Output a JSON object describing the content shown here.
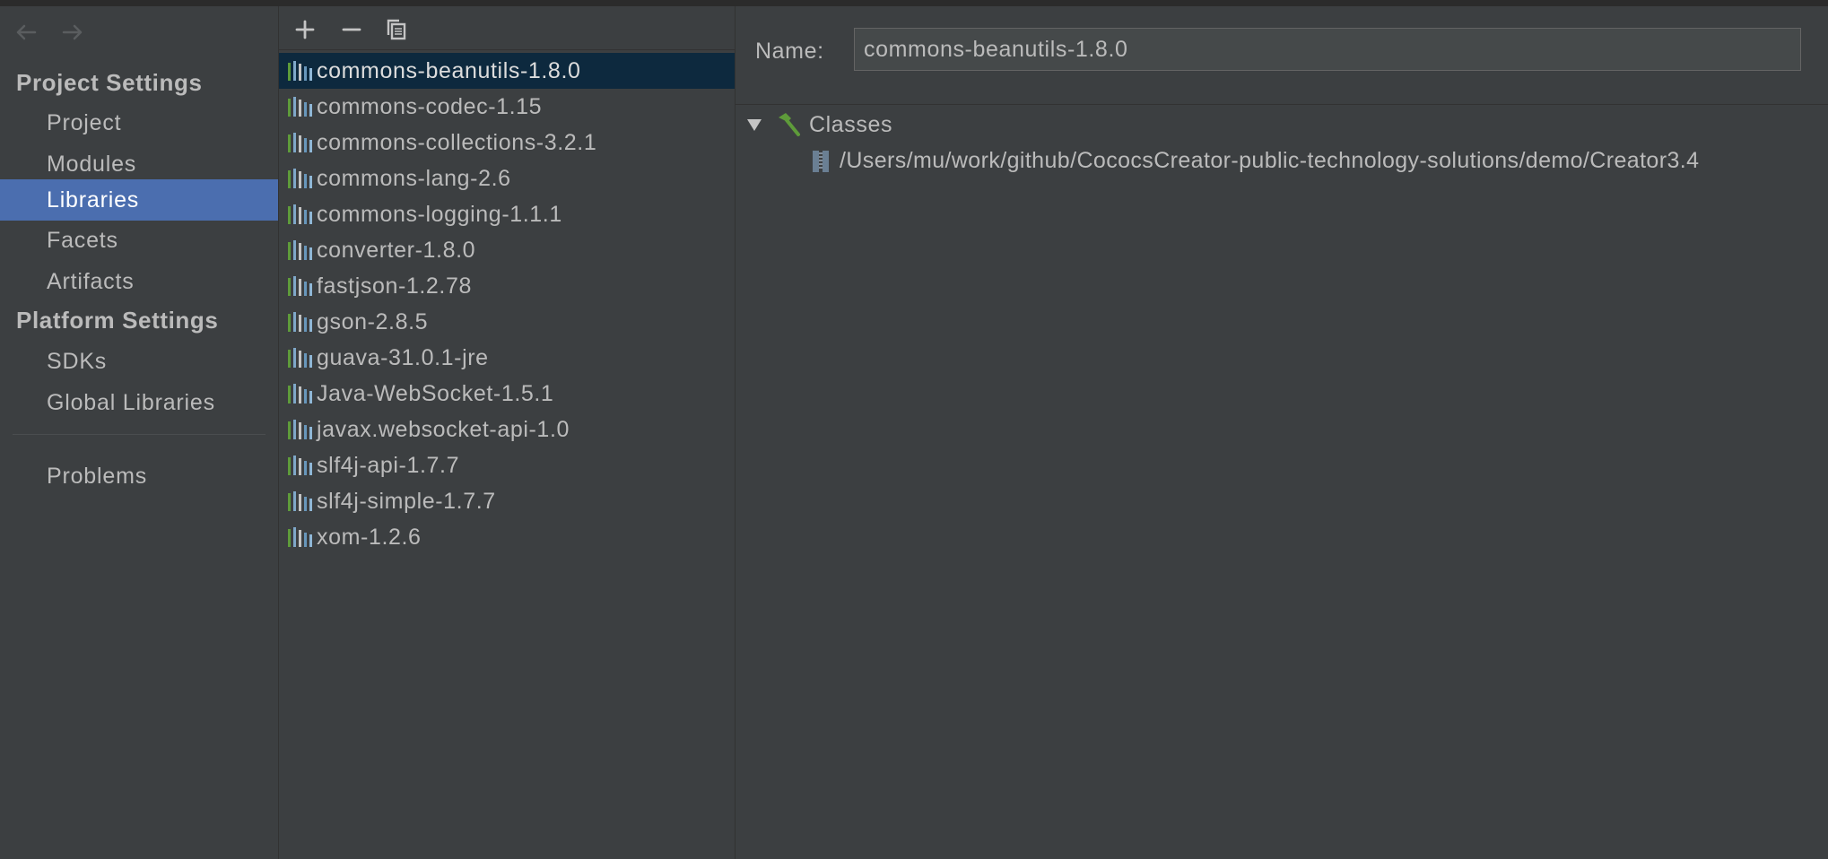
{
  "sidebar": {
    "project_settings_title": "Project Settings",
    "project_items": [
      {
        "label": "Project",
        "selected": false
      },
      {
        "label": "Modules",
        "selected": false
      },
      {
        "label": "Libraries",
        "selected": true
      },
      {
        "label": "Facets",
        "selected": false
      },
      {
        "label": "Artifacts",
        "selected": false
      }
    ],
    "platform_settings_title": "Platform Settings",
    "platform_items": [
      {
        "label": "SDKs"
      },
      {
        "label": "Global Libraries"
      }
    ],
    "problems_label": "Problems"
  },
  "toolbar": {
    "add_icon": "plus-icon",
    "remove_icon": "minus-icon",
    "copy_icon": "copy-icon"
  },
  "libraries": [
    "commons-beanutils-1.8.0",
    "commons-codec-1.15",
    "commons-collections-3.2.1",
    "commons-lang-2.6",
    "commons-logging-1.1.1",
    "converter-1.8.0",
    "fastjson-1.2.78",
    "gson-2.8.5",
    "guava-31.0.1-jre",
    "Java-WebSocket-1.5.1",
    "javax.websocket-api-1.0",
    "slf4j-api-1.7.7",
    "slf4j-simple-1.7.7",
    "xom-1.2.6"
  ],
  "selected_library_index": 0,
  "detail": {
    "name_label": "Name:",
    "name_value": "commons-beanutils-1.8.0",
    "classes_label": "Classes",
    "class_path": "/Users/mu/work/github/CococsCreator-public-technology-solutions/demo/Creator3.4"
  },
  "colors": {
    "background": "#3c3f41",
    "sidebar_selected": "#4b6eaf",
    "list_selected": "#0d293e",
    "text": "#bbbbbb",
    "classes_icon": "#5e9b3a"
  }
}
